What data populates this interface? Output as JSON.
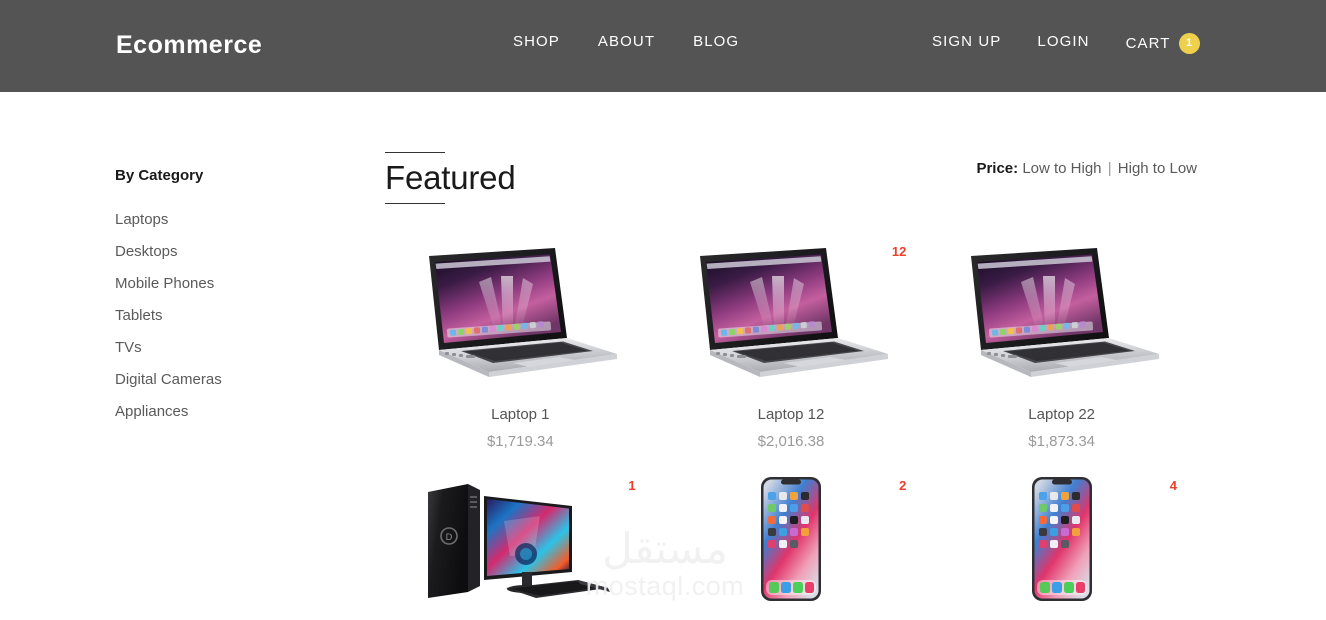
{
  "header": {
    "brand": "Ecommerce",
    "nav_main": [
      {
        "label": "SHOP",
        "name": "nav-shop"
      },
      {
        "label": "ABOUT",
        "name": "nav-about"
      },
      {
        "label": "BLOG",
        "name": "nav-blog"
      }
    ],
    "nav_right": [
      {
        "label": "SIGN UP",
        "name": "nav-signup"
      },
      {
        "label": "LOGIN",
        "name": "nav-login"
      }
    ],
    "cart_label": "CART",
    "cart_count": "1",
    "bg_color": "#545454",
    "badge_color": "#efd04c"
  },
  "sidebar": {
    "title": "By Category",
    "items": [
      {
        "label": "Laptops"
      },
      {
        "label": "Desktops"
      },
      {
        "label": "Mobile Phones"
      },
      {
        "label": "Tablets"
      },
      {
        "label": "TVs"
      },
      {
        "label": "Digital Cameras"
      },
      {
        "label": "Appliances"
      }
    ]
  },
  "main": {
    "heading": "Featured",
    "sort": {
      "label": "Price:",
      "low_to_high": "Low to High",
      "separator": "|",
      "high_to_low": "High to Low"
    }
  },
  "products": {
    "row1": [
      {
        "name": "Laptop 1",
        "price": "$1,719.34",
        "badge": "",
        "image": "macbook-pro-laptop-image"
      },
      {
        "name": "Laptop 12",
        "price": "$2,016.38",
        "badge": "12",
        "image": "macbook-pro-laptop-image"
      },
      {
        "name": "Laptop 22",
        "price": "$1,873.34",
        "badge": "",
        "image": "macbook-pro-laptop-image"
      }
    ],
    "row2": [
      {
        "name": "",
        "price": "",
        "badge": "1",
        "image": "dell-desktop-monitor-keyboard-image"
      },
      {
        "name": "",
        "price": "",
        "badge": "2",
        "image": "iphone-x-smartphone-image"
      },
      {
        "name": "",
        "price": "",
        "badge": "4",
        "image": "iphone-x-smartphone-image"
      }
    ]
  },
  "watermark": {
    "arabic": "مستقل",
    "latin": "mostaql.com"
  },
  "colors": {
    "badge_red": "#e8402a",
    "product_name": "#555555",
    "product_price": "#9a9a9a",
    "sidebar_item": "#5a5a5a"
  }
}
